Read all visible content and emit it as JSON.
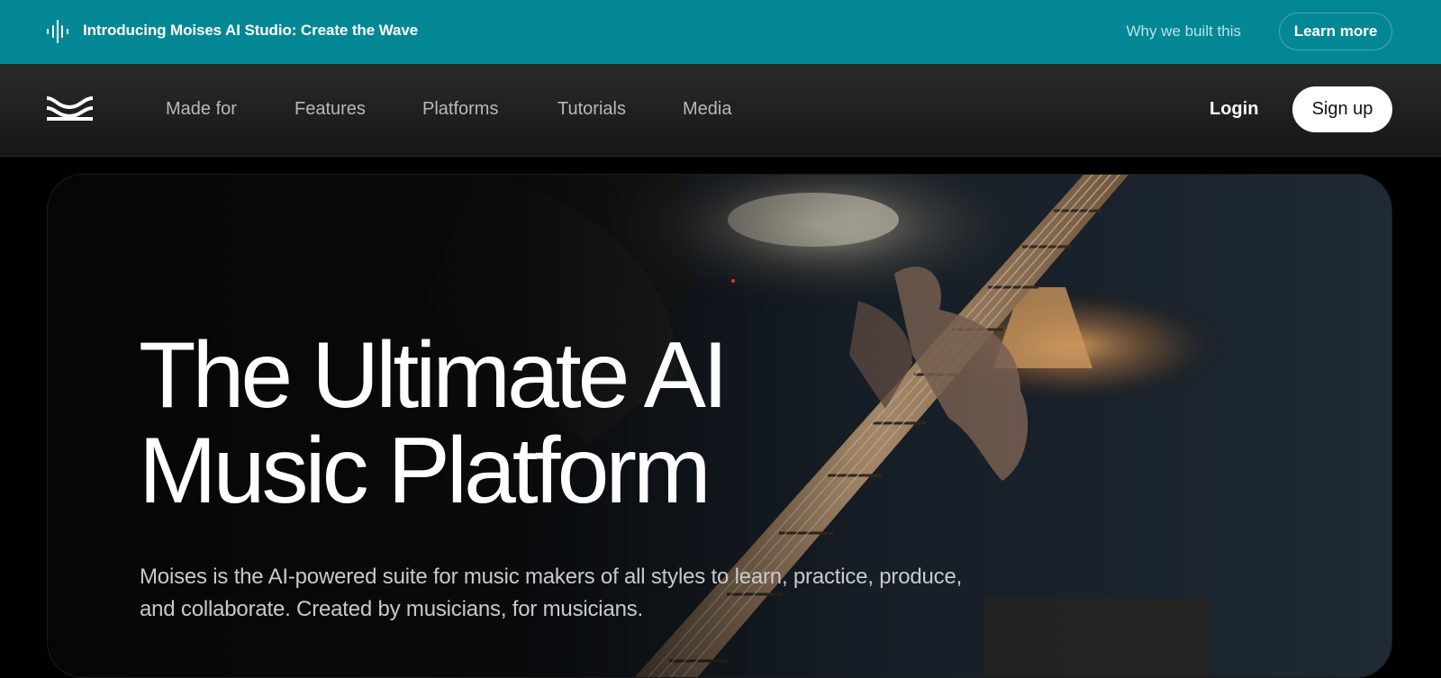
{
  "announcement": {
    "text": "Introducing Moises AI Studio: Create the Wave",
    "icon": "waveform-icon",
    "why_link": "Why we built this",
    "learn_more": "Learn more"
  },
  "nav": {
    "logo_icon": "moises-wave-logo-icon",
    "links": [
      {
        "label": "Made for"
      },
      {
        "label": "Features"
      },
      {
        "label": "Platforms"
      },
      {
        "label": "Tutorials"
      },
      {
        "label": "Media"
      }
    ],
    "login": "Login",
    "signup": "Sign up"
  },
  "hero": {
    "title_line1": "The Ultimate AI",
    "title_line2": "Music Platform",
    "subtitle": "Moises is the AI-powered suite for music makers of all styles to learn, practice, produce, and collaborate. Created by musicians, for musicians.",
    "background_image": "guitarist-playing-electric-guitar-photo"
  },
  "colors": {
    "announcement_bg": "#048794",
    "nav_bg": "#1f1f1f",
    "page_bg": "#000000",
    "signup_bg": "#ffffff"
  }
}
